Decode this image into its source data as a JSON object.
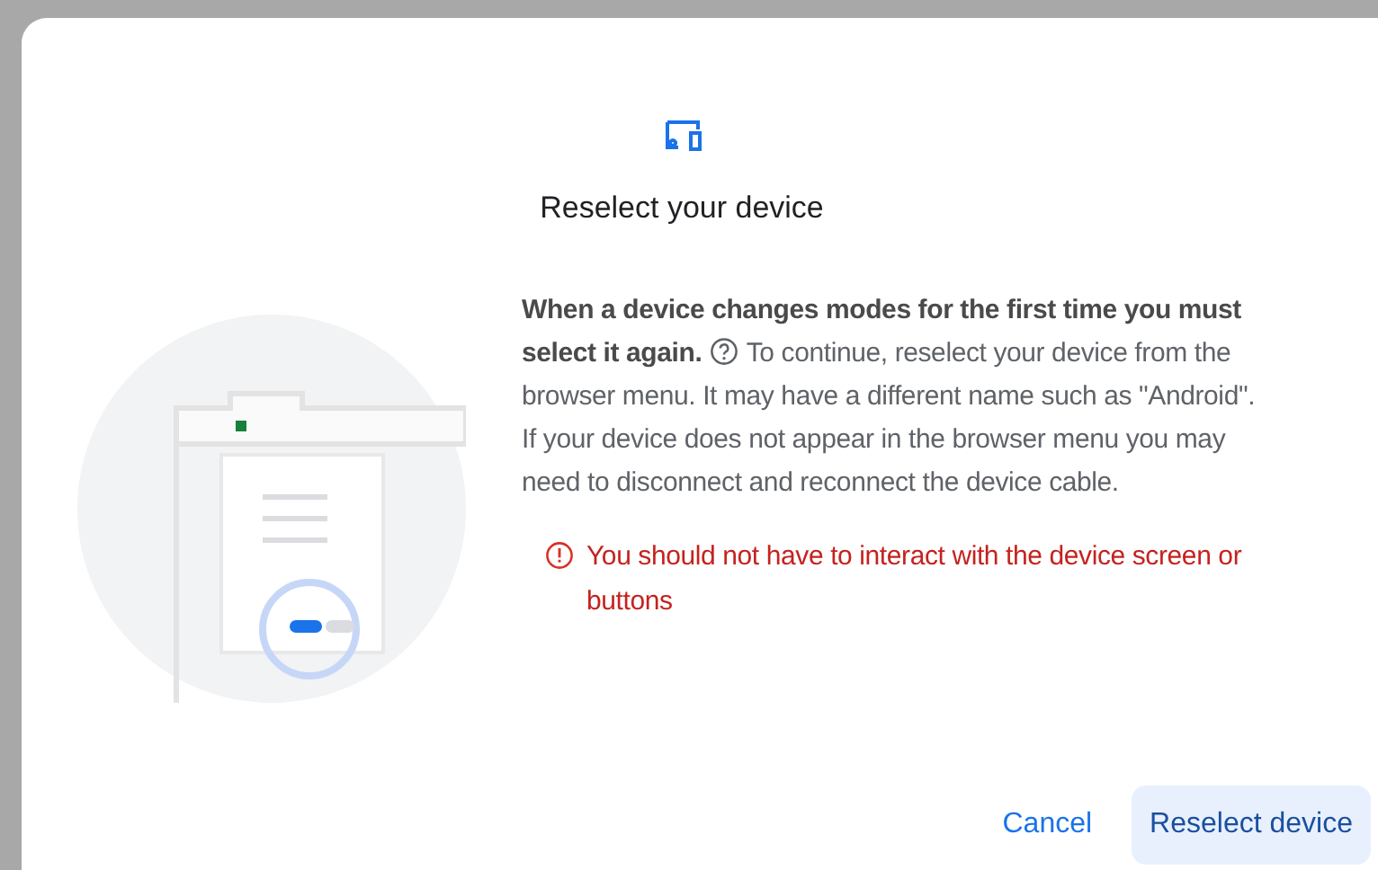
{
  "dialog": {
    "title": "Reselect your device",
    "message": {
      "lead": "When a device changes modes for the first time you must select it again.",
      "text": "To continue, reselect your device from the browser menu. It may have a different name such as \"Android\". If your device does not appear in the browser menu you may need to disconnect and reconnect the device cable."
    },
    "warning": "You should not have to interact with the device screen or buttons",
    "buttons": [
      {
        "label": "Cancel",
        "kind": "text"
      },
      {
        "label": "Reselect device",
        "kind": "tonal"
      }
    ]
  }
}
